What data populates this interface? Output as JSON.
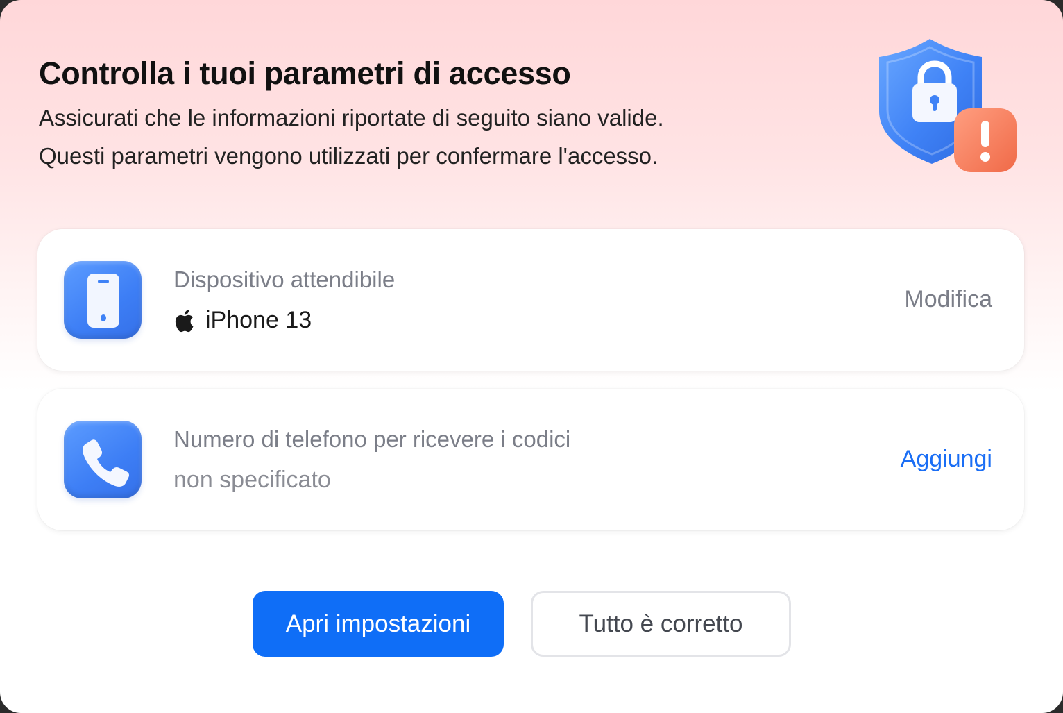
{
  "header": {
    "title": "Controlla i tuoi parametri di accesso",
    "subtitle_line1": "Assicurati che le informazioni riportate di seguito siano valide.",
    "subtitle_line2": "Questi parametri vengono utilizzati per confermare l'accesso.",
    "hero_icon": "shield-lock-warning-icon"
  },
  "cards": [
    {
      "icon": "smartphone-icon",
      "label": "Dispositivo attendibile",
      "value_icon": "apple-logo-icon",
      "value": "iPhone 13",
      "action": "Modifica"
    },
    {
      "icon": "phone-icon",
      "label": "Numero di telefono per ricevere i codici",
      "value": "non specificato",
      "action": "Aggiungi"
    }
  ],
  "buttons": {
    "primary": "Apri impostazioni",
    "secondary": "Tutto è corretto"
  },
  "colors": {
    "accent": "#0f6ef7",
    "link": "#1a6ef5",
    "warning": "#f47c5c",
    "header_gradient": "#ffd7d9"
  }
}
